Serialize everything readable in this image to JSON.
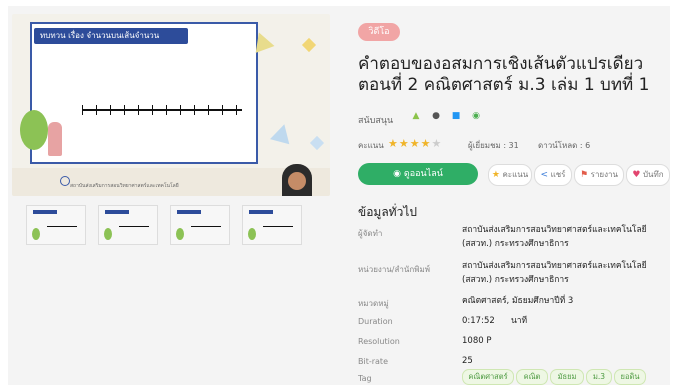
{
  "media": {
    "slide_title": "ทบทวน เรื่อง จำนวนบนเส้นจำนวน",
    "footer_text": "สถาบันส่งเสริมการสอนวิทยาศาสตร์และเทคโนโลยี",
    "thumbnails": [
      "thumb-1",
      "thumb-2",
      "thumb-3",
      "thumb-4"
    ]
  },
  "item": {
    "type_badge": "วิดีโอ",
    "title": "คำตอบของอสมการเชิงเส้นตัวแปรเดียว ตอนที่ 2 คณิตศาสตร์ ม.3 เล่ม 1 บทที่ 1",
    "support_label": "สนับสนุน",
    "platforms": [
      {
        "name": "android-icon",
        "glyph": "▲",
        "color": "#8bc34a"
      },
      {
        "name": "apple-icon",
        "glyph": "●",
        "color": "#555555"
      },
      {
        "name": "windows-icon",
        "glyph": "■",
        "color": "#2196f3"
      },
      {
        "name": "web-icon",
        "glyph": "◉",
        "color": "#4caf50"
      }
    ],
    "rating_label": "คะแนน",
    "rating": 4,
    "rating_max": 5,
    "views": "ผู้เยี่ยมชม : 31",
    "downloads": "ดาวน์โหลด : 6"
  },
  "actions": {
    "watch_label": "ดูออนไลน์",
    "rate_label": "คะแนน",
    "share_label": "แชร์",
    "report_label": "รายงาน",
    "save_label": "บันทึก"
  },
  "info": {
    "section_title": "ข้อมูลทั่วไป",
    "rows": [
      {
        "label": "ผู้จัดทำ",
        "value": "สถาบันส่งเสริมการสอนวิทยาศาสตร์และเทคโนโลยี (สสวท.) กระทรวงศึกษาธิการ"
      },
      {
        "label": "หน่วยงาน/สำนักพิมพ์",
        "value": "สถาบันส่งเสริมการสอนวิทยาศาสตร์และเทคโนโลยี (สสวท.) กระทรวงศึกษาธิการ"
      },
      {
        "label": "หมวดหมู่",
        "value": "คณิตศาสตร์, มัธยมศึกษาปีที่ 3"
      },
      {
        "label": "Duration",
        "value": "0:17:52      นาที"
      },
      {
        "label": "Resolution",
        "value": "1080 P"
      },
      {
        "label": "Bit-rate",
        "value": "25"
      },
      {
        "label": "Tag",
        "value": ""
      }
    ],
    "tags": [
      "คณิตศาสตร์",
      "คณิต",
      "มัธยม",
      "ม.3",
      "ยอดิน"
    ]
  },
  "colors": {
    "accent_green": "#2fae66",
    "badge_pink": "#f1a5a5",
    "star": "#f0b429"
  }
}
